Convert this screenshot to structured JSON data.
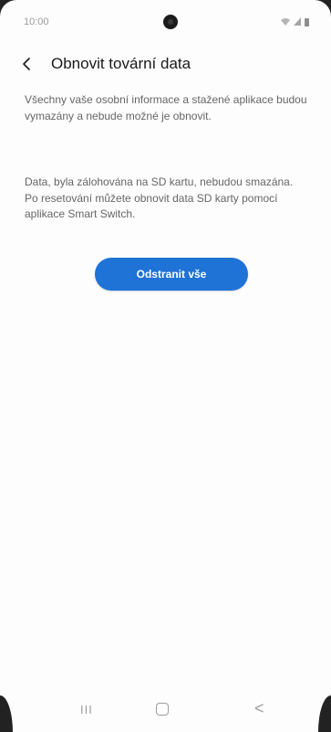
{
  "status_bar": {
    "time": "10:00",
    "signal_text": "‡.⊿"
  },
  "header": {
    "back_icon": "chevron-left-icon",
    "title": "Obnovit tovární data"
  },
  "content": {
    "paragraph_1": "Všechny vaše osobní informace a stažené aplikace budou vymazány a nebude možné je obnovit.",
    "paragraph_2": "Data, byla zálohována na SD kartu, nebudou smazána. Po resetování můžete obnovit data SD karty pomocí aplikace Smart Switch."
  },
  "actions": {
    "primary_label": "Odstranit vše"
  },
  "nav_bar": {
    "recents_label": "III",
    "home_icon": "home-icon",
    "back_label": "<"
  },
  "colors": {
    "accent": "#1f72d6",
    "text_primary": "#1a1a1a",
    "text_secondary": "#666666",
    "background": "#fdfdfd"
  }
}
